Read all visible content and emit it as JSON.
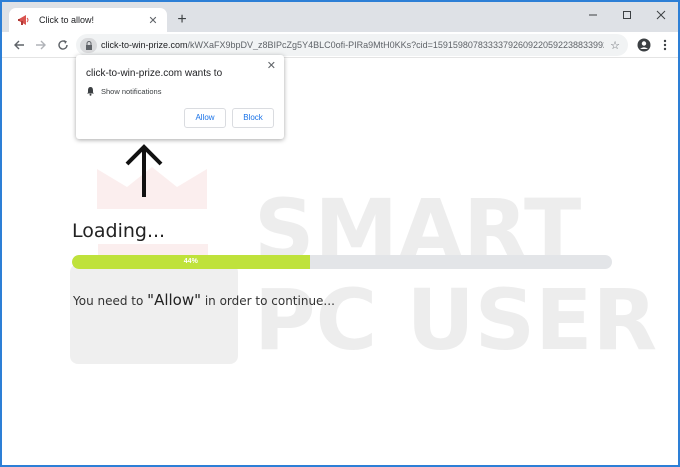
{
  "browser": {
    "tab_title": "Click to allow!",
    "tab_close": "✕",
    "new_tab": "+",
    "url_host": "click-to-win-prize.com",
    "url_path": "/kWXaFX9bpDV_z8BIPcZg5Y4BLC0ofi-PIRa9MtH0KKs?cid=159159807833337926092205922388339​92...",
    "controls": {
      "minimize": "—",
      "maximize": "☐",
      "close": "✕"
    }
  },
  "popup": {
    "title": "click-to-win-prize.com wants to",
    "permission": "Show notifications",
    "allow_label": "Allow",
    "block_label": "Block",
    "close": "✕"
  },
  "page": {
    "loading": "Loading...",
    "progress_percent": 44,
    "progress_label": "44%",
    "continue_prefix": "You need to ",
    "continue_highlight": "\"Allow\"",
    "continue_suffix": " in order to continue..."
  },
  "watermark": {
    "line1": "SMART",
    "line2": "PC USER"
  },
  "colors": {
    "window_border": "#2d7fd6",
    "progress_fill": "#bfe23b",
    "button_text": "#1a73e8"
  }
}
